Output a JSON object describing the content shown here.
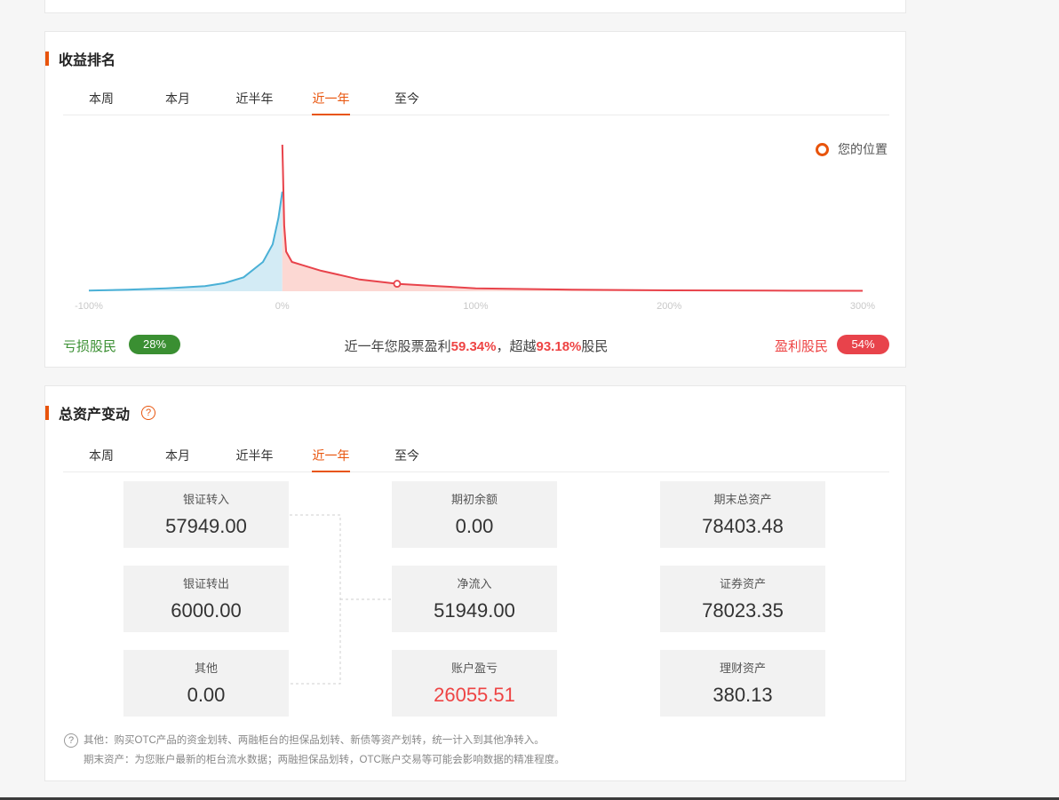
{
  "ranking": {
    "title": "收益排名",
    "tabs": [
      "本周",
      "本月",
      "近半年",
      "近一年",
      "至今"
    ],
    "active_tab": "近一年",
    "legend_position": "您的位置",
    "x_axis_ticks": [
      "-100%",
      "0%",
      "100%",
      "200%",
      "300%"
    ],
    "loss_label": "亏损股民",
    "loss_pct": "28%",
    "gain_label": "盈利股民",
    "gain_pct": "54%",
    "summary_prefix": "近一年您股票盈利",
    "summary_profit": "59.34%",
    "summary_mid": "，超越",
    "summary_beat": "93.18%",
    "summary_suffix": "股民",
    "colors": {
      "loss": "#3a8f32",
      "gain": "#e8434b",
      "accent": "#e8540c",
      "loss_curve": "#4ab0d6"
    }
  },
  "chart_data": {
    "type": "area",
    "xlabel": "",
    "ylabel": "",
    "xlim": [
      -100,
      300
    ],
    "x_ticks": [
      -100,
      0,
      100,
      200,
      300
    ],
    "your_position": 59.34,
    "loss_series": {
      "x": [
        -100,
        -80,
        -60,
        -40,
        -30,
        -20,
        -10,
        -5,
        -2,
        0
      ],
      "y": [
        0.004,
        0.01,
        0.02,
        0.035,
        0.055,
        0.095,
        0.2,
        0.32,
        0.5,
        0.68
      ]
    },
    "gain_series": {
      "x": [
        0,
        0.3,
        1,
        2,
        5,
        10,
        20,
        30,
        40,
        60,
        80,
        100,
        150,
        200,
        250,
        300
      ],
      "y": [
        1.0,
        0.85,
        0.45,
        0.27,
        0.2,
        0.18,
        0.14,
        0.11,
        0.08,
        0.05,
        0.035,
        0.02,
        0.01,
        0.006,
        0.004,
        0.003
      ]
    }
  },
  "assets": {
    "title": "总资产变动",
    "help_icon": "question-icon",
    "tabs": [
      "本周",
      "本月",
      "近半年",
      "近一年",
      "至今"
    ],
    "active_tab": "近一年",
    "left": [
      {
        "label": "银证转入",
        "value": "57949.00"
      },
      {
        "label": "银证转出",
        "value": "6000.00"
      },
      {
        "label": "其他",
        "value": "0.00"
      }
    ],
    "middle": [
      {
        "label": "期初余额",
        "value": "0.00"
      },
      {
        "label": "净流入",
        "value": "51949.00"
      },
      {
        "label": "账户盈亏",
        "value": "26055.51"
      }
    ],
    "right": [
      {
        "label": "期末总资产",
        "value": "78403.48"
      },
      {
        "label": "证券资产",
        "value": "78023.35"
      },
      {
        "label": "理财资产",
        "value": "380.13"
      }
    ],
    "note1": "其他：购买OTC产品的资金划转、两融柜台的担保品划转、新债等资产划转，统一计入到其他净转入。",
    "note2": "期末资产：为您账户最新的柜台流水数据；两融担保品划转，OTC账户交易等可能会影响数据的精准程度。"
  }
}
